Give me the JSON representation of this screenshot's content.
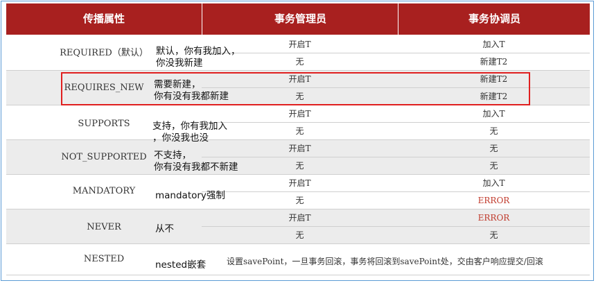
{
  "table": {
    "headers": [
      "传播属性",
      "事务管理员",
      "事务协调员"
    ],
    "rows": [
      {
        "prop": "REQUIRED（默认）",
        "note": "默认，你有我加入，\n你没我新建",
        "mgr": [
          "开启T",
          "无"
        ],
        "coord": [
          "加入T",
          "新建T2"
        ]
      },
      {
        "prop": "REQUIRES_NEW",
        "note": "需要新建，\n你有没有我都新建",
        "mgr": [
          "开启T",
          "无"
        ],
        "coord": [
          "新建T2",
          "新建T2"
        ]
      },
      {
        "prop": "SUPPORTS",
        "note": "支持，你有我加入\n，你没我也没",
        "mgr": [
          "开启T",
          "无"
        ],
        "coord": [
          "加入T",
          "无"
        ]
      },
      {
        "prop": "NOT_SUPPORTED",
        "note": "不支持，\n你有没有我都不新建",
        "mgr": [
          "开启T",
          "无"
        ],
        "coord": [
          "无",
          "无"
        ]
      },
      {
        "prop": "MANDATORY",
        "note": "mandatory强制",
        "mgr": [
          "开启T",
          "无"
        ],
        "coord": [
          "加入T",
          "ERROR"
        ]
      },
      {
        "prop": "NEVER",
        "note": "从不",
        "mgr": [
          "开启T",
          "无"
        ],
        "coord": [
          "ERROR",
          "无"
        ]
      },
      {
        "prop": "NESTED",
        "note": "nested嵌套",
        "desc": "设置savePoint，一旦事务回滚，事务将回滚到savePoint处，交由客户响应提交/回滚"
      }
    ]
  },
  "colors": {
    "header_bg": "#a8201f",
    "error": "#c0392b",
    "highlight_border": "#e01f1f"
  }
}
